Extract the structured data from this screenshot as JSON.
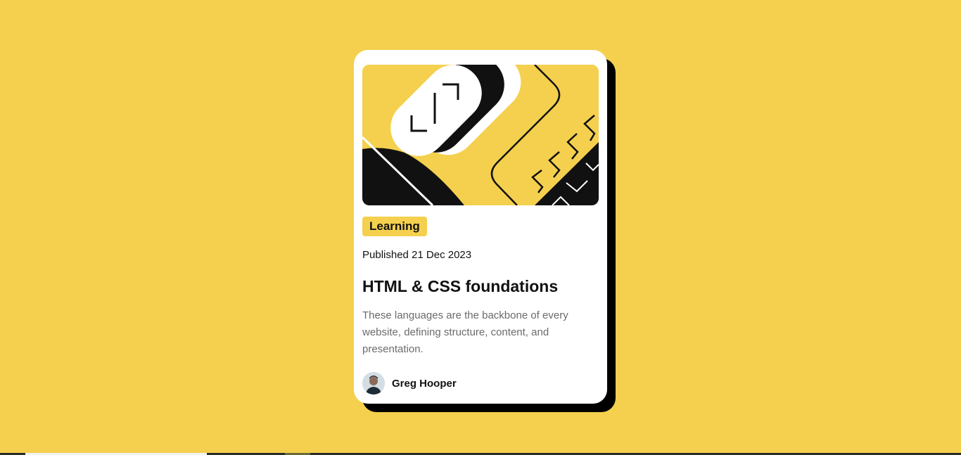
{
  "card": {
    "tag": "Learning",
    "published": "Published 21 Dec 2023",
    "title": "HTML & CSS foundations",
    "description": "These languages are the backbone of every website, defining structure, content, and presentation.",
    "author": "Greg Hooper"
  },
  "colors": {
    "background": "#F4D04E",
    "card": "#FFFFFF",
    "shadow": "#000000",
    "text": "#111111",
    "muted": "#6B6B6B"
  },
  "icons": {
    "hero": "abstract-illustration",
    "avatar": "author-avatar"
  }
}
